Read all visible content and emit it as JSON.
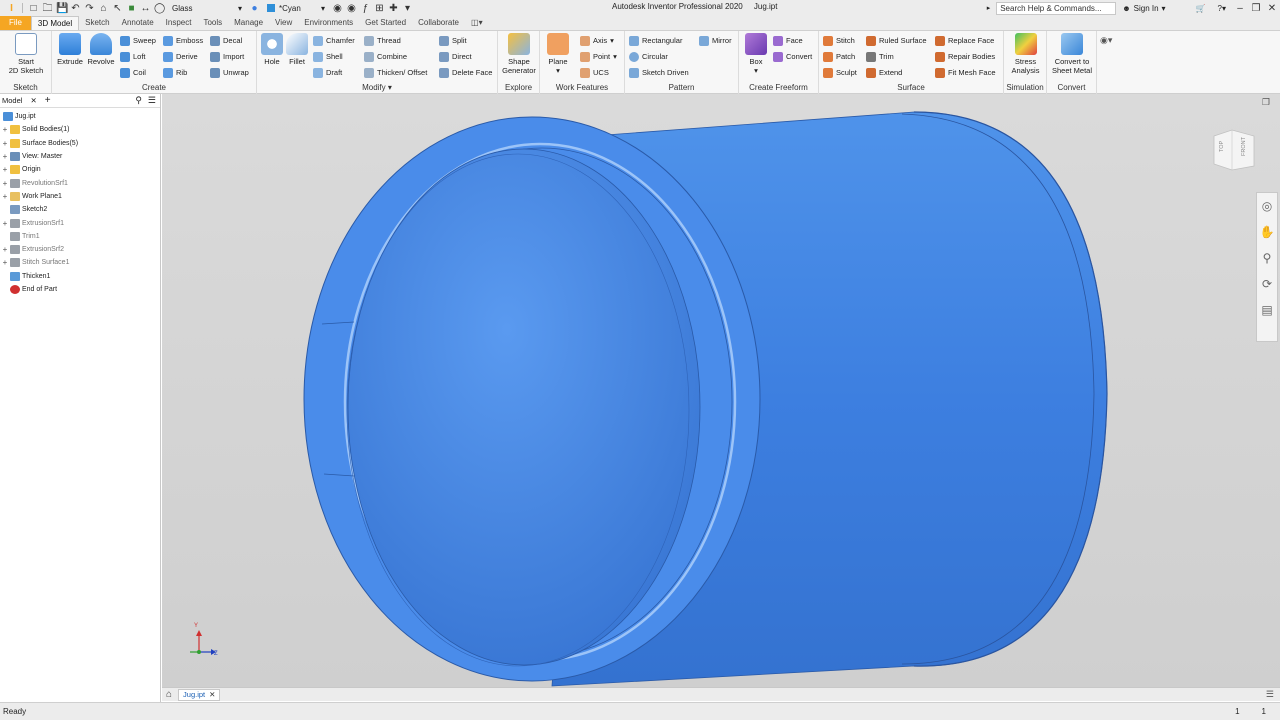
{
  "app": {
    "title": "Autodesk Inventor Professional 2020",
    "document": "Jug.ipt",
    "material": "Glass",
    "appearance": "*Cyan",
    "search_placeholder": "Search Help & Commands...",
    "sign_in": "Sign In"
  },
  "tabs": [
    "File",
    "3D Model",
    "Sketch",
    "Annotate",
    "Inspect",
    "Tools",
    "Manage",
    "View",
    "Environments",
    "Get Started",
    "Collaborate"
  ],
  "ribbon": {
    "sketch": {
      "label": "Sketch",
      "start": "Start",
      "sketch2d": "2D Sketch"
    },
    "create": {
      "label": "Create",
      "extrude": "Extrude",
      "revolve": "Revolve",
      "sweep": "Sweep",
      "loft": "Loft",
      "coil": "Coil",
      "emboss": "Emboss",
      "derive": "Derive",
      "rib": "Rib",
      "decal": "Decal",
      "import": "Import",
      "unwrap": "Unwrap"
    },
    "modify": {
      "label": "Modify",
      "hole": "Hole",
      "fillet": "Fillet",
      "chamfer": "Chamfer",
      "shell": "Shell",
      "draft": "Draft",
      "thread": "Thread",
      "combine": "Combine",
      "thicken": "Thicken/ Offset",
      "split": "Split",
      "direct": "Direct",
      "delete_face": "Delete Face"
    },
    "explore": {
      "label": "Explore",
      "shape1": "Shape",
      "shape2": "Generator"
    },
    "work": {
      "label": "Work Features",
      "plane": "Plane",
      "axis": "Axis",
      "point": "Point",
      "ucs": "UCS"
    },
    "pattern": {
      "label": "Pattern",
      "rectangular": "Rectangular",
      "circular": "Circular",
      "sketch_driven": "Sketch Driven",
      "mirror": "Mirror"
    },
    "freeform": {
      "label": "Create Freeform",
      "box": "Box",
      "face": "Face",
      "convert": "Convert"
    },
    "surface": {
      "label": "Surface",
      "stitch": "Stitch",
      "patch": "Patch",
      "sculpt": "Sculpt",
      "ruled": "Ruled Surface",
      "trim": "Trim",
      "extend": "Extend",
      "replace": "Replace Face",
      "repair": "Repair Bodies",
      "fitmesh": "Fit Mesh Face"
    },
    "simulation": {
      "label": "Simulation",
      "stress1": "Stress",
      "stress2": "Analysis"
    },
    "convert": {
      "label": "Convert",
      "c1": "Convert to",
      "c2": "Sheet Metal"
    }
  },
  "browser": {
    "tab": "Model",
    "nodes": [
      {
        "label": "Jug.ipt",
        "expand": "",
        "color": "#4a8fd8",
        "gray": false
      },
      {
        "label": "Solid Bodies(1)",
        "expand": "+",
        "color": "#f0c040",
        "gray": false
      },
      {
        "label": "Surface Bodies(5)",
        "expand": "+",
        "color": "#f0c040",
        "gray": false
      },
      {
        "label": "View: Master",
        "expand": "+",
        "color": "#6a8fb8",
        "gray": false
      },
      {
        "label": "Origin",
        "expand": "+",
        "color": "#f0c040",
        "gray": false
      },
      {
        "label": "RevolutionSrf1",
        "expand": "+",
        "color": "#9aa0a8",
        "gray": true
      },
      {
        "label": "Work Plane1",
        "expand": "+",
        "color": "#e8c060",
        "gray": false
      },
      {
        "label": "Sketch2",
        "expand": "",
        "color": "#7a9ac0",
        "gray": false
      },
      {
        "label": "ExtrusionSrf1",
        "expand": "+",
        "color": "#9aa0a8",
        "gray": true
      },
      {
        "label": "Trim1",
        "expand": "",
        "color": "#9aa0a8",
        "gray": true
      },
      {
        "label": "ExtrusionSrf2",
        "expand": "+",
        "color": "#9aa0a8",
        "gray": true
      },
      {
        "label": "Stitch Surface1",
        "expand": "+",
        "color": "#9aa0a8",
        "gray": true
      },
      {
        "label": "Thicken1",
        "expand": "",
        "color": "#5a9ad8",
        "gray": false
      },
      {
        "label": "End of Part",
        "expand": "",
        "color": "#d03030",
        "gray": false
      }
    ]
  },
  "viewcube": {
    "top": "TOP",
    "front": "FRONT"
  },
  "triad": {
    "y": "Y",
    "z": "Z"
  },
  "doc_tab": "Jug.ipt",
  "status": {
    "text": "Ready",
    "n1": "1",
    "n2": "1"
  },
  "colors": {
    "part": "#3d7fe0",
    "part_dark": "#2e66c4",
    "part_light": "#5a9af0",
    "ribbon_file": "#f5a623"
  }
}
